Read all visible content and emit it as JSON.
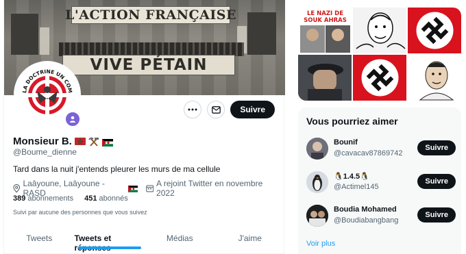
{
  "banner": {
    "sign_top": "L'ACTION FRANÇAISE",
    "sign_bottom": "VIVE PÉTAIN"
  },
  "avatar": {
    "ring_text": "LA DOCTRINE UN COMBAT"
  },
  "actions": {
    "follow_label": "Suivre"
  },
  "profile": {
    "display_name": "Monsieur B.",
    "handle": "@Boume_dienne",
    "bio": "Tard dans la nuit j'entends pleurer les murs de ma cellule",
    "location": "Laâyoune, Laâyoune - RASD",
    "joined": "A rejoint Twitter en novembre 2022",
    "following_count": "389",
    "following_label": "abonnements",
    "followers_count": "451",
    "followers_label": "abonnés",
    "followed_note": "Suivi par aucune des personnes que vous suivez"
  },
  "tabs": [
    {
      "label": "Tweets"
    },
    {
      "label": "Tweets et réponses"
    },
    {
      "label": "Médias"
    },
    {
      "label": "J'aime"
    }
  ],
  "media": {
    "thumb1_caption_1": "LE NAZI DE",
    "thumb1_caption_2": "SOUK AHRAS"
  },
  "suggestions": {
    "title": "Vous pourriez aimer",
    "items": [
      {
        "name": "Bounif",
        "handle": "@cavacav87869742",
        "follow": "Suivre"
      },
      {
        "name": "🐧1.4.5🐧",
        "handle": "@Actimel145",
        "follow": "Suivre"
      },
      {
        "name": "Boudia Mohamed",
        "handle": "@Boudiabangbang",
        "follow": "Suivre"
      }
    ],
    "see_more": "Voir plus"
  },
  "colors": {
    "accent": "#1d9bf0",
    "button_dark": "#0f1419",
    "muted_text": "#536471",
    "badge_purple": "#7b63d6"
  }
}
